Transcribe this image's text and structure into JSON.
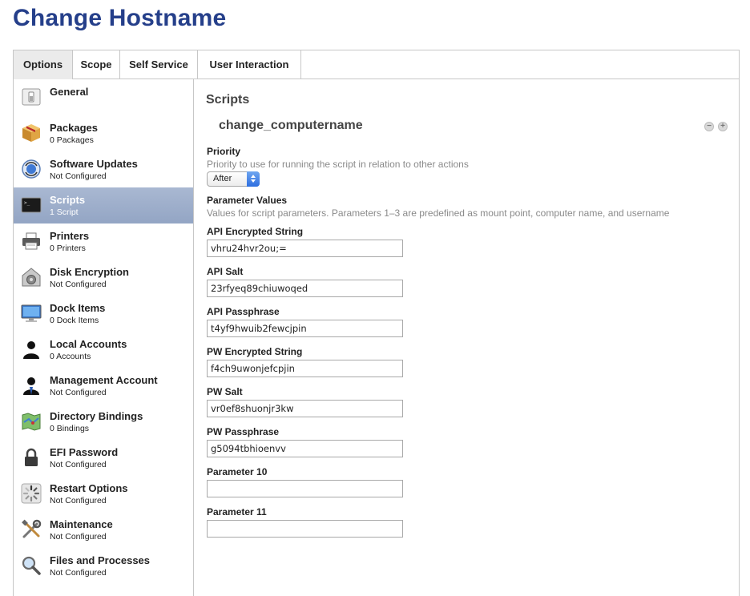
{
  "page": {
    "title": "Change Hostname"
  },
  "tabs": [
    {
      "label": "Options",
      "active": true
    },
    {
      "label": "Scope"
    },
    {
      "label": "Self Service"
    },
    {
      "label": "User Interaction"
    }
  ],
  "sidebar": {
    "items": [
      {
        "label": "General",
        "sub": "",
        "icon": "general-switch-icon"
      },
      {
        "label": "Packages",
        "sub": "0 Packages",
        "icon": "package-box-icon"
      },
      {
        "label": "Software Updates",
        "sub": "Not Configured",
        "icon": "software-update-icon"
      },
      {
        "label": "Scripts",
        "sub": "1 Script",
        "icon": "terminal-icon",
        "active": true
      },
      {
        "label": "Printers",
        "sub": "0 Printers",
        "icon": "printer-icon"
      },
      {
        "label": "Disk Encryption",
        "sub": "Not Configured",
        "icon": "disk-encryption-icon"
      },
      {
        "label": "Dock Items",
        "sub": "0 Dock Items",
        "icon": "monitor-icon"
      },
      {
        "label": "Local Accounts",
        "sub": "0 Accounts",
        "icon": "user-silhouette-icon"
      },
      {
        "label": "Management Account",
        "sub": "Not Configured",
        "icon": "management-user-icon"
      },
      {
        "label": "Directory Bindings",
        "sub": "0 Bindings",
        "icon": "directory-map-icon"
      },
      {
        "label": "EFI Password",
        "sub": "Not Configured",
        "icon": "padlock-icon"
      },
      {
        "label": "Restart Options",
        "sub": "Not Configured",
        "icon": "restart-spinner-icon"
      },
      {
        "label": "Maintenance",
        "sub": "Not Configured",
        "icon": "tools-icon"
      },
      {
        "label": "Files and Processes",
        "sub": "Not Configured",
        "icon": "magnifier-icon"
      }
    ]
  },
  "main": {
    "section_title": "Scripts",
    "script_name": "change_computername",
    "priority": {
      "label": "Priority",
      "description": "Priority to use for running the script in relation to other actions",
      "value": "After"
    },
    "parameters": {
      "label": "Parameter Values",
      "description": "Values for script parameters. Parameters 1–3 are predefined as mount point, computer name, and username",
      "fields": [
        {
          "label": "API Encrypted String",
          "value": "vhru24hvr2ou;="
        },
        {
          "label": "API Salt",
          "value": "23rfyeq89chiuwoqed"
        },
        {
          "label": "API Passphrase",
          "value": "t4yf9hwuib2fewcjpin"
        },
        {
          "label": "PW Encrypted String",
          "value": "f4ch9uwonjefcpjin"
        },
        {
          "label": "PW Salt",
          "value": "vr0ef8shuonjr3kw"
        },
        {
          "label": "PW Passphrase",
          "value": "g5094tbhioenvv"
        },
        {
          "label": "Parameter 10",
          "value": ""
        },
        {
          "label": "Parameter 11",
          "value": ""
        }
      ]
    },
    "controls": {
      "remove_symbol": "−",
      "add_symbol": "+"
    }
  },
  "colors": {
    "title": "#253f8a",
    "active_sidebar": "#9aabc8",
    "select_accent": "#2d6ee0"
  }
}
